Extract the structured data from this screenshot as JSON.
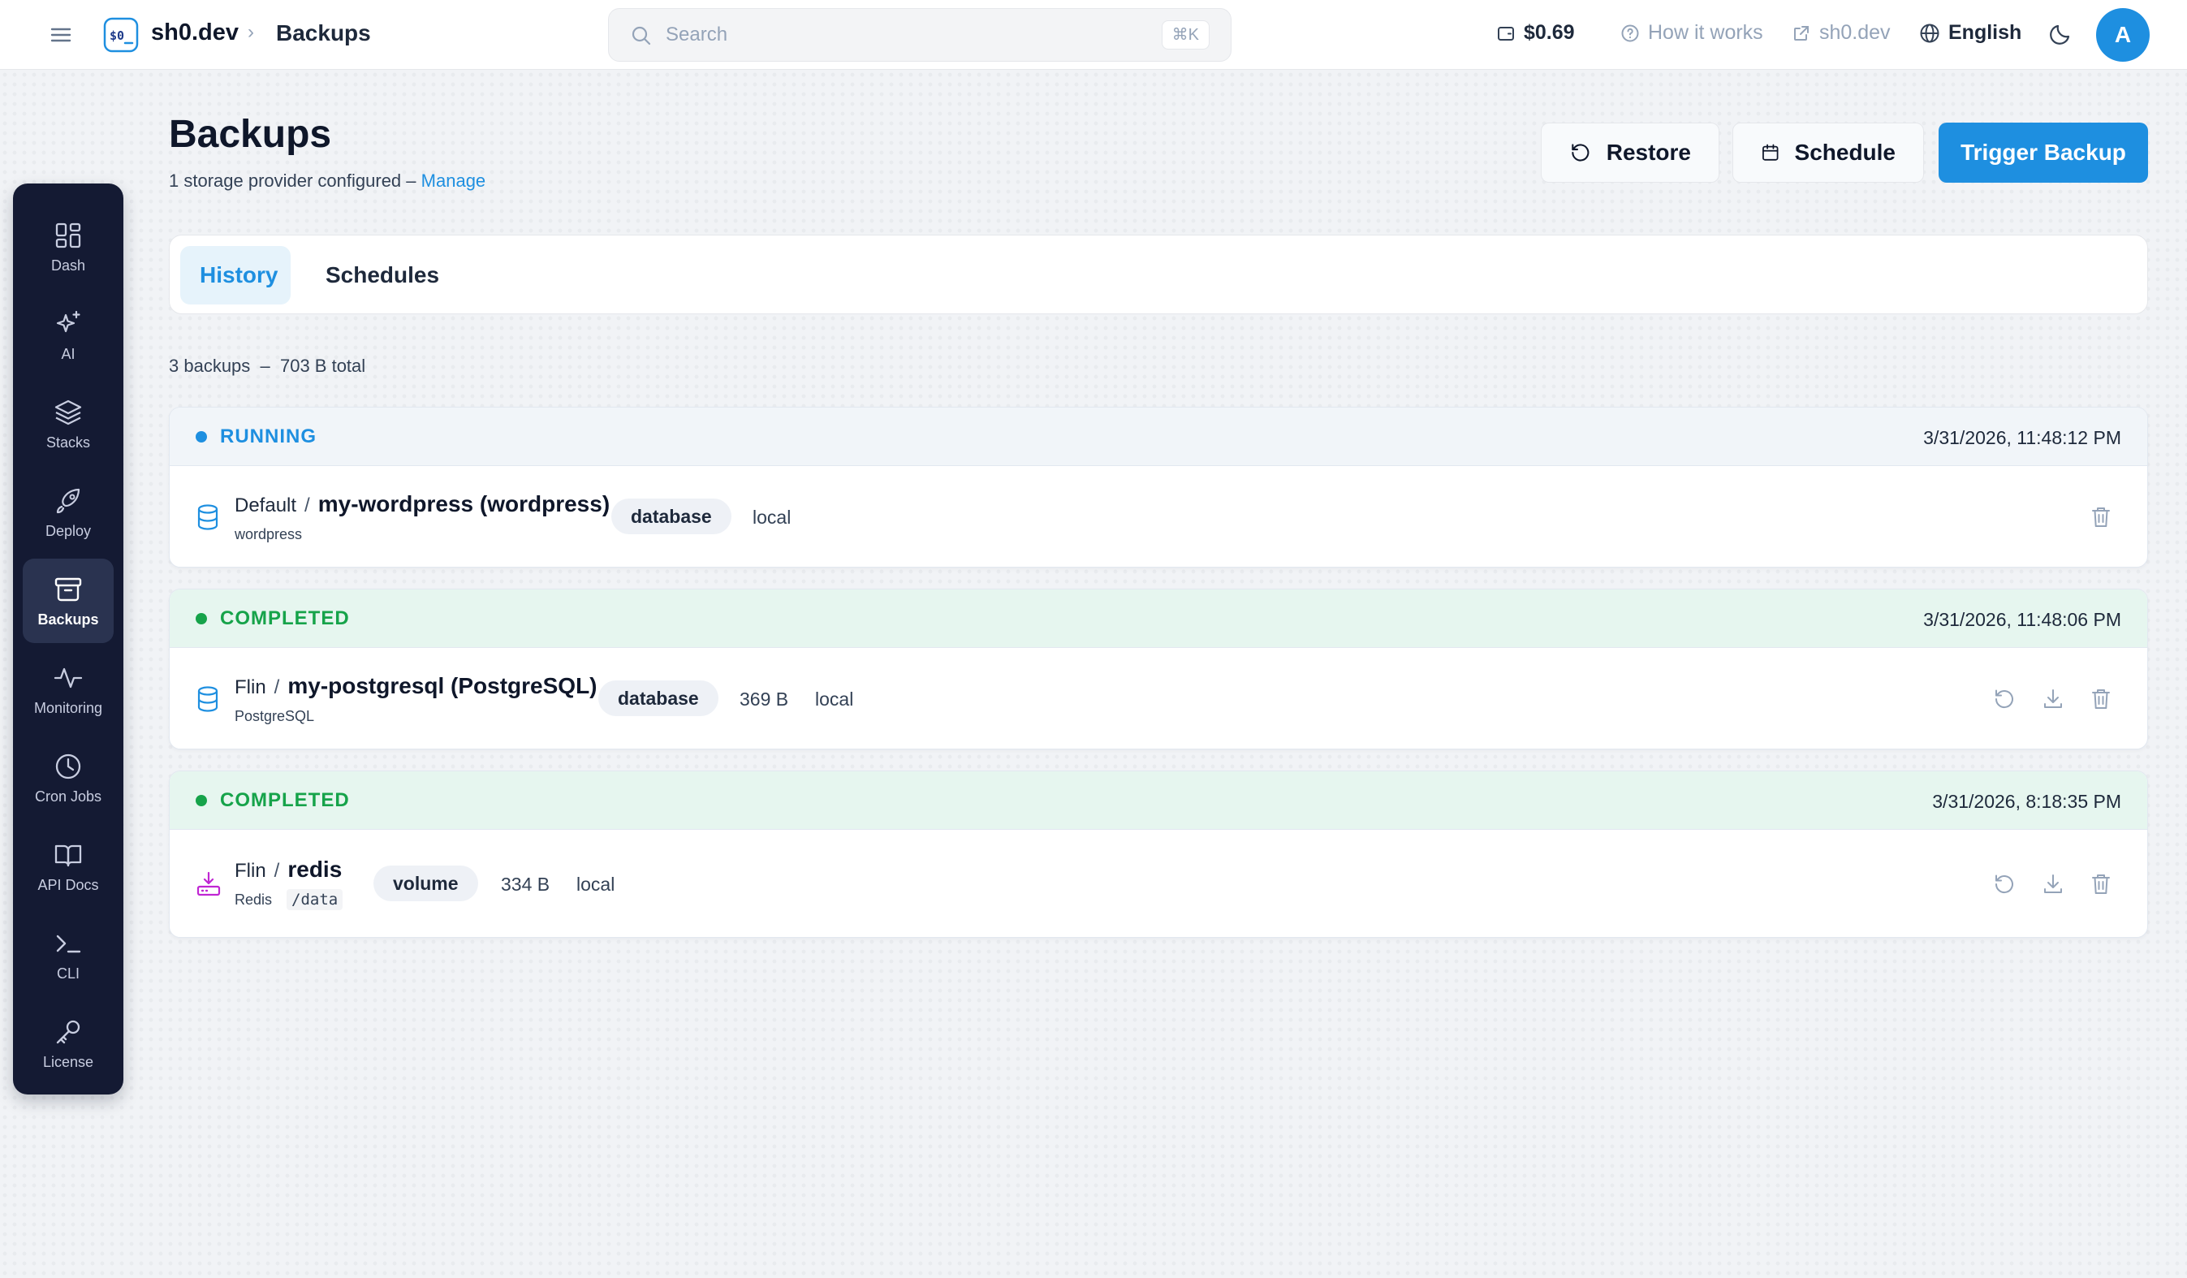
{
  "header": {
    "brand": "sh0.dev",
    "breadcrumb": "Backups",
    "search_placeholder": "Search",
    "search_shortcut": "⌘K",
    "balance": "$0.69",
    "how_it_works": "How it works",
    "external_link": "sh0.dev",
    "language": "English",
    "avatar_initial": "A"
  },
  "sidebar": {
    "items": [
      {
        "label": "Dash",
        "icon": "dashboard-icon"
      },
      {
        "label": "AI",
        "icon": "sparkles-icon"
      },
      {
        "label": "Stacks",
        "icon": "layers-icon"
      },
      {
        "label": "Deploy",
        "icon": "rocket-icon"
      },
      {
        "label": "Backups",
        "icon": "archive-icon",
        "active": true
      },
      {
        "label": "Monitoring",
        "icon": "activity-icon"
      },
      {
        "label": "Cron Jobs",
        "icon": "clock-icon"
      },
      {
        "label": "API Docs",
        "icon": "book-icon"
      },
      {
        "label": "CLI",
        "icon": "terminal-icon"
      },
      {
        "label": "License",
        "icon": "key-icon"
      }
    ]
  },
  "page": {
    "title": "Backups",
    "subtitle_text": "1 storage provider configured –",
    "subtitle_link": "Manage",
    "buttons": {
      "restore": "Restore",
      "schedule": "Schedule",
      "trigger": "Trigger Backup"
    },
    "tabs": {
      "history": "History",
      "schedules": "Schedules"
    },
    "summary": "3 backups  –  703 B total"
  },
  "backups": [
    {
      "status": "RUNNING",
      "timestamp": "3/31/2026, 11:48:12 PM",
      "project": "Default",
      "separator": "/",
      "resource": "my-wordpress (wordpress)",
      "sub": "wordpress",
      "path": "",
      "type": "database",
      "size": "",
      "storage": "local",
      "icon": "database-icon"
    },
    {
      "status": "COMPLETED",
      "timestamp": "3/31/2026, 11:48:06 PM",
      "project": "Flin",
      "separator": "/",
      "resource": "my-postgresql (PostgreSQL)",
      "sub": "PostgreSQL",
      "path": "",
      "type": "database",
      "size": "369 B",
      "storage": "local",
      "icon": "database-icon"
    },
    {
      "status": "COMPLETED",
      "timestamp": "3/31/2026, 8:18:35 PM",
      "project": "Flin",
      "separator": "/",
      "resource": "redis",
      "sub": "Redis",
      "path": "/data",
      "type": "volume",
      "size": "334 B",
      "storage": "local",
      "icon": "hard-drive-download-icon"
    }
  ],
  "colors": {
    "accent": "#1e8fe0",
    "sidebar_bg": "#141a33",
    "success": "#16a34a",
    "completed_header_bg": "#e6f6ef",
    "volume_icon": "#c026d3"
  }
}
